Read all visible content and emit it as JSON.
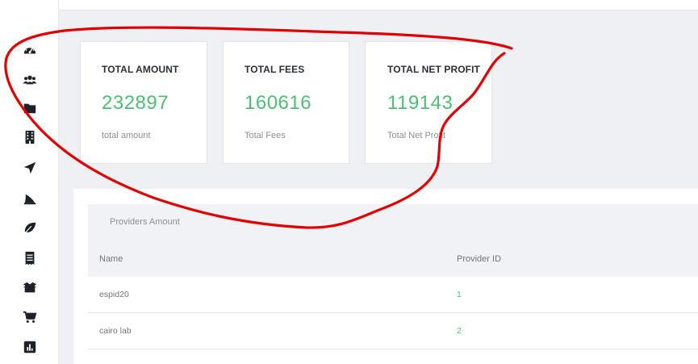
{
  "sidebar": {
    "icons": [
      {
        "icon": "dashboard-gauge-icon"
      },
      {
        "icon": "users-icon"
      },
      {
        "icon": "folder-icon"
      },
      {
        "icon": "building-icon"
      },
      {
        "icon": "location-arrow-icon"
      },
      {
        "icon": "shark-fin-icon"
      },
      {
        "icon": "leaf-icon"
      },
      {
        "icon": "receipt-icon"
      },
      {
        "icon": "box-open-icon"
      },
      {
        "icon": "shopping-cart-icon"
      },
      {
        "icon": "bar-chart-icon"
      }
    ]
  },
  "cards": [
    {
      "title": "TOTAL AMOUNT",
      "value": "232897",
      "subtitle": "total amount"
    },
    {
      "title": "TOTAL FEES",
      "value": "160616",
      "subtitle": "Total Fees"
    },
    {
      "title": "TOTAL NET PROFIT",
      "value": "119143",
      "subtitle": "Total Net Profit"
    }
  ],
  "providers": {
    "title": "Providers Amount",
    "columns": [
      "Name",
      "Provider ID"
    ],
    "rows": [
      {
        "name": "espid20",
        "id": "1"
      },
      {
        "name": "cairo lab",
        "id": "2"
      }
    ]
  },
  "colors": {
    "accent_green": "#4cbf73",
    "annotation_red": "#e00000"
  }
}
